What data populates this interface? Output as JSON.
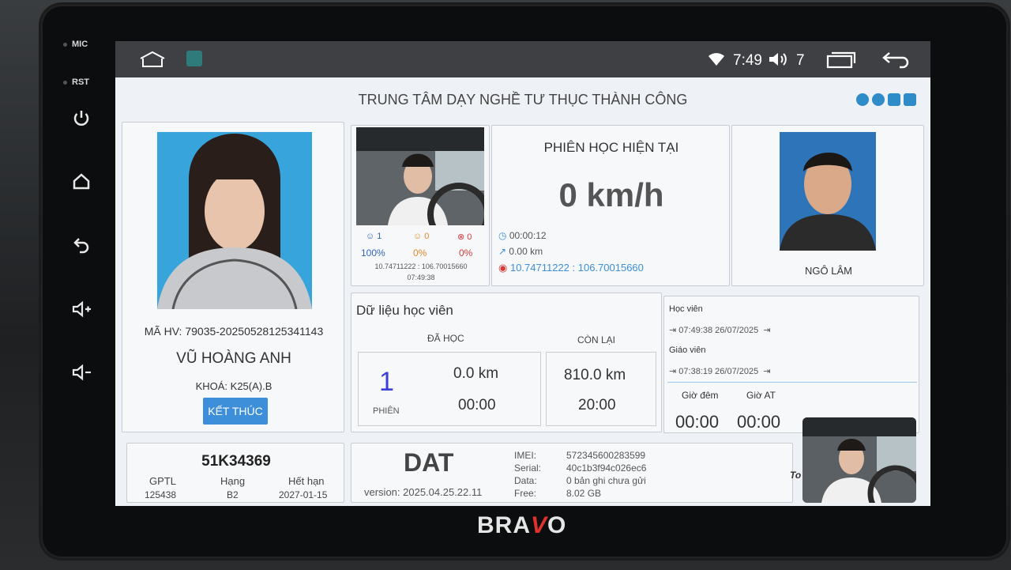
{
  "device": {
    "mic_label": "MIC",
    "rst_label": "RST",
    "brand_pre": "BRA",
    "brand_v": "V",
    "brand_post": "O"
  },
  "statusbar": {
    "time": "7:49",
    "volume": "7"
  },
  "app": {
    "title": "TRUNG TÂM DẠY NGHỀ TƯ THỤC THÀNH CÔNG"
  },
  "student": {
    "code": "MÃ HV: 79035-20250528125341143",
    "name": "VŨ HOÀNG ANH",
    "course": "KHOÁ: K25(A).B",
    "end_button": "KẾT THÚC"
  },
  "camera": {
    "stat1": "1",
    "stat2": "0",
    "stat3": "0",
    "pct1": "100%",
    "pct2": "0%",
    "pct3": "0%",
    "coords": "10.74711222 : 106.70015660",
    "time": "07:49:38"
  },
  "session": {
    "title": "PHIÊN HỌC HIỆN TẠI",
    "speed": "0 km/h",
    "duration": "00:00:12",
    "distance": "0.00 km",
    "coords": "10.74711222 : 106.70015660"
  },
  "teacher": {
    "name": "NGÔ LÂM"
  },
  "learner_data": {
    "title": "Dữ liệu học viên",
    "learned_header": "ĐÃ HỌC",
    "remaining_header": "CÒN LẠI",
    "session_count": "1",
    "session_unit": "PHIÊN",
    "learned_km": "0.0 km",
    "learned_time": "00:00",
    "remaining_km": "810.0 km",
    "remaining_time": "20:00"
  },
  "log": {
    "student_label": "Học viên",
    "student_time": "07:49:38 26/07/2025",
    "teacher_label": "Giáo viên",
    "teacher_time": "07:38:19 26/07/2025",
    "night_label": "Giờ đêm",
    "auto_label": "Giờ AT",
    "night_value": "00:00",
    "auto_value": "00:00",
    "cam_label": "To"
  },
  "vehicle": {
    "plate": "51K34369",
    "gptl_label": "GPTL",
    "gptl_value": "125438",
    "class_label": "Hạng",
    "class_value": "B2",
    "expiry_label": "Hết hạn",
    "expiry_value": "2027-01-15"
  },
  "device_info": {
    "name": "DAT",
    "version": "version: 2025.04.25.22.11",
    "imei_label": "IMEI:",
    "imei": "572345600283599",
    "serial_label": "Serial:",
    "serial": "40c1b3f94c026ec6",
    "data_label": "Data:",
    "data": "0 bản ghi chưa gửi",
    "free_label": "Free:",
    "free": "8.02 GB"
  }
}
